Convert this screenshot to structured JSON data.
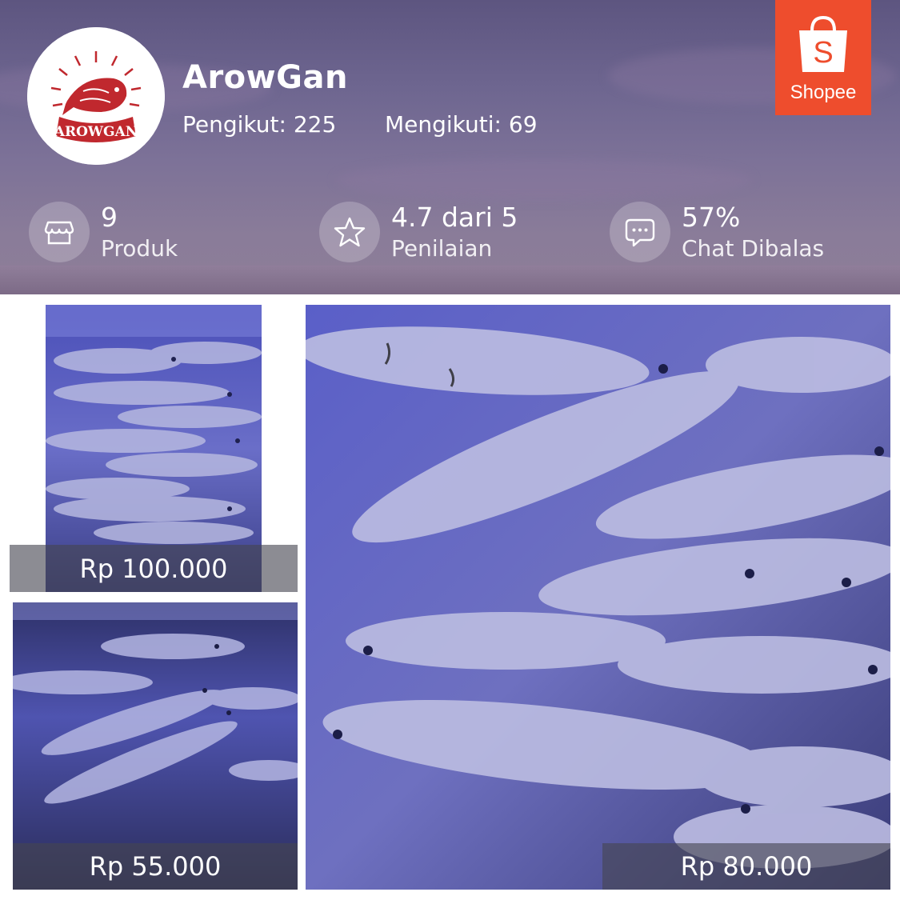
{
  "shop": {
    "name": "ArowGan",
    "logo_text": "AROWGAN",
    "followers": "Pengikut: 225",
    "following": "Mengikuti: 69"
  },
  "platform": {
    "name": "Shopee",
    "brand_color": "#ee4d2d"
  },
  "stats": [
    {
      "value": "9",
      "label": "Produk",
      "icon": "store-icon"
    },
    {
      "value": "4.7 dari 5",
      "label": "Penilaian",
      "icon": "star-icon"
    },
    {
      "value": "57%",
      "label": "Chat Dibalas",
      "icon": "chat-icon"
    }
  ],
  "products": [
    {
      "price": "Rp 100.000"
    },
    {
      "price": "Rp 55.000"
    },
    {
      "price": "Rp 80.000"
    }
  ]
}
